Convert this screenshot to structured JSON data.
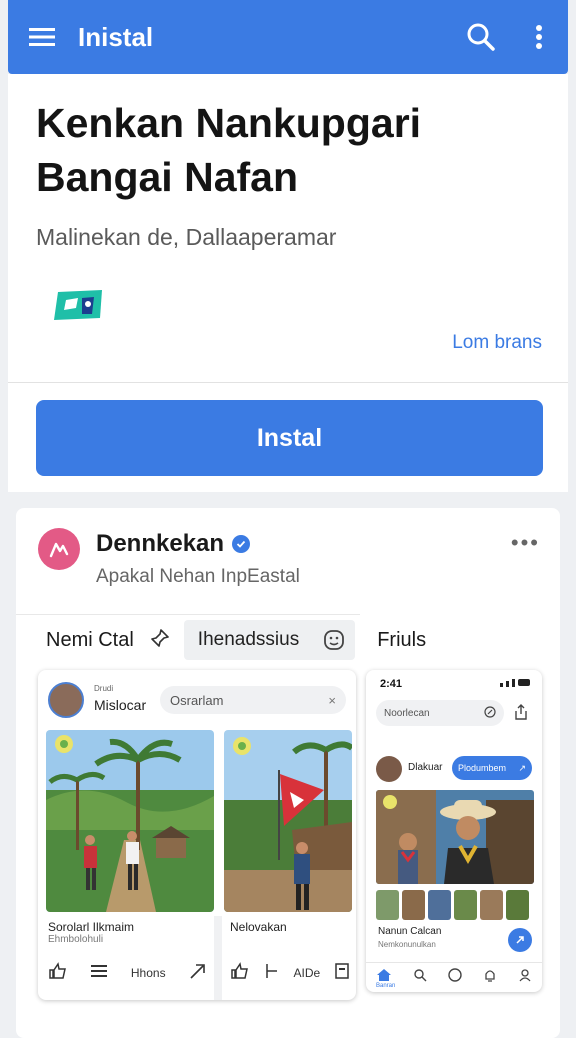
{
  "appbar": {
    "title": "Inistal",
    "color": "#3b7be3",
    "icons": [
      "hamburger-menu-icon",
      "search-icon",
      "more-vert-icon"
    ]
  },
  "hero": {
    "title": "Kenkan Nankupgari Bangai Nafan",
    "subtitle": "Malinekan de, Dallaaperamar",
    "more_link": "Lom brans",
    "install_label": "Instal"
  },
  "post": {
    "author": "Dennkekan",
    "subtitle": "Apakal Nehan InpEastal",
    "menu_dots": "•••",
    "tabs": {
      "tab_one": "Nemi Ctal",
      "tab_two": "Ihenadssius",
      "tab_three": "Friuls"
    }
  },
  "feed_card": {
    "meta": "Drudi",
    "username": "Mislocar",
    "search_text": "Osrarlam",
    "close_symbol": "×",
    "caption_left": "Sorolarl Ilkmaim",
    "caption_left_sub": "Ehmbolohuli",
    "caption_right": "Nelovakan",
    "actions_left_label": "Hhons",
    "actions_right_label": "AIDe"
  },
  "phone_preview": {
    "time": "2:41",
    "search_text": "Noorlecan",
    "name": "Dlakuar",
    "follow_label": "Plodumbem",
    "caption": "Nanun Calcan",
    "caption_sub": "Nemkonunulkan",
    "nav_label": "Banran"
  }
}
